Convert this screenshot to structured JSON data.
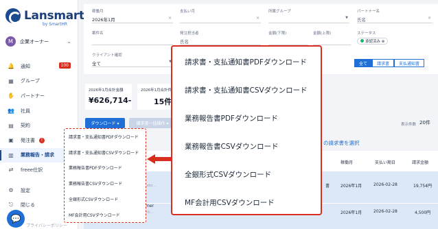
{
  "brand": {
    "name": "Lansmart",
    "sub": "by SmartHR"
  },
  "account": {
    "initial": "M",
    "name": "企業オーナー"
  },
  "nav": [
    {
      "icon": "bell-icon",
      "glyph": "🔔",
      "label": "通知",
      "badge": "100"
    },
    {
      "icon": "building-icon",
      "glyph": "▦",
      "label": "グループ"
    },
    {
      "icon": "handshake-icon",
      "glyph": "✋",
      "label": "パートナー"
    },
    {
      "icon": "people-icon",
      "glyph": "👥",
      "label": "社員"
    },
    {
      "icon": "contract-icon",
      "glyph": "▤",
      "label": "契約"
    },
    {
      "icon": "document-icon",
      "glyph": "▣",
      "label": "発注書",
      "badge": "!"
    },
    {
      "icon": "report-icon",
      "glyph": "▥",
      "label": "業務報告・請求",
      "active": true
    },
    {
      "icon": "freee-icon",
      "glyph": "⇄",
      "label": "freee仕訳"
    },
    {
      "icon": "gear-icon",
      "glyph": "⚙",
      "label": "設定"
    },
    {
      "icon": "logout-icon",
      "glyph": "⎋",
      "label": "閉じる"
    }
  ],
  "footer": "プライバシーポリシー",
  "filters": {
    "period_label": "稼働月",
    "period_value": "2026年1月",
    "payment_label": "支払い月",
    "payment_value": "",
    "group_label": "所属グループ",
    "group_value": "",
    "partner_label": "パートナー名",
    "partner_placeholder": "氏名",
    "case_label": "案件名",
    "case_value": "",
    "orderer_label": "発注担当者",
    "orderer_placeholder": "氏名",
    "amount_min_label": "金額(下限)",
    "amount_max_label": "金額(上限)",
    "status_label": "ステータス",
    "status_chip": "承認済み",
    "client_label": "クライアント確認",
    "client_value": "全て",
    "segments": [
      "全て",
      "請求書",
      "支払通知書"
    ]
  },
  "summary": [
    {
      "title": "2026年1月合計金額",
      "value": "¥626,714-"
    },
    {
      "title": "2026年1月合計件数",
      "value": "15件"
    }
  ],
  "toolbar": {
    "download": "ダウンロード ▾",
    "bulk": "請求書一括操作 ▾",
    "per_page_label": "表示件数",
    "per_page_value": "20件",
    "select_link": "の請求書を選択"
  },
  "table": {
    "headers": [
      "稼働月",
      "支払い期日",
      "請求金額"
    ],
    "rows": [
      {
        "partner": "書",
        "month": "2026年1月",
        "due": "2026-02-28",
        "amount": "19,754円",
        "note": "...+350<cloudsi..."
      },
      {
        "partner": "mer",
        "month": "2026年1月",
        "due": "2026-02-28",
        "amount": "4,500円",
        "note": "...agkpod.parti..."
      }
    ]
  },
  "download_menu": [
    "請求書・支払通知書PDFダウンロード",
    "請求書・支払通知書CSVダウンロード",
    "業務報告書PDFダウンロード",
    "業務報告書CSVダウンロード",
    "全銀形式CSVダウンロード",
    "MF会計用CSVダウンロード"
  ],
  "colors": {
    "primary": "#1f6fd6",
    "brand": "#1c3f7a",
    "highlight": "#d92d20"
  }
}
